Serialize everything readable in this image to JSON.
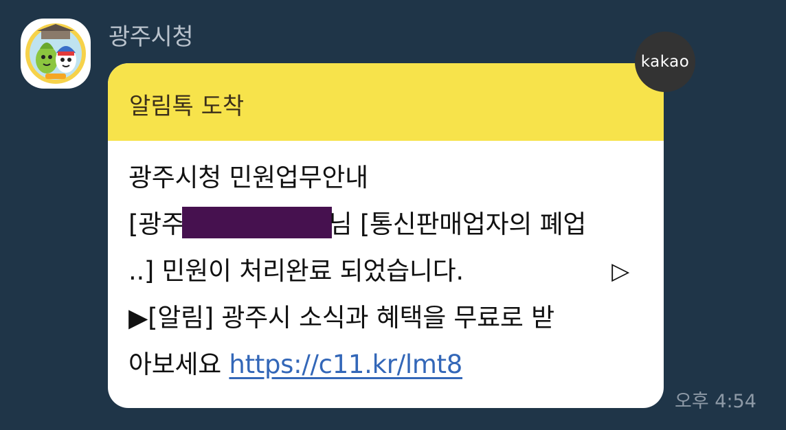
{
  "sender": {
    "name": "광주시청",
    "avatar_icon": "gwangju-mascot-avatar"
  },
  "badge": {
    "label": "kakao"
  },
  "message": {
    "header_title": "알림톡 도착",
    "lines": {
      "l1": "광주시청 민원업무안내",
      "l2_prefix": "[광주",
      "l2_suffix": "님 [통신판매업자의 폐업",
      "l3": "..] 민원이 처리완료 되었습니다.",
      "l3_play": "▷",
      "l4": "▶[알림] 광주시 소식과 혜택을 무료로 받",
      "l5_prefix": "아보세요 ",
      "link": "https://c11.kr/lmt8"
    }
  },
  "timestamp": "오후 4:54",
  "colors": {
    "background": "#1f3548",
    "header_yellow": "#f7e34b",
    "redaction": "#46114f",
    "link": "#3367b8"
  }
}
